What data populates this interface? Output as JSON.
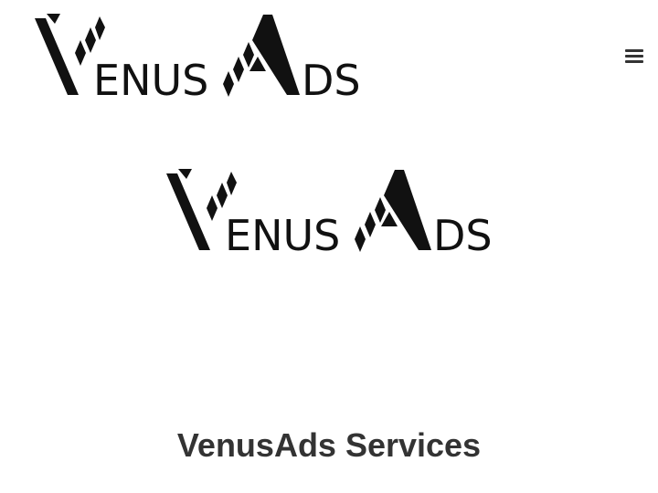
{
  "header": {
    "logo_alt": "VenusAds",
    "logo_text_1": "ENUS",
    "logo_text_2": "DS",
    "menu_icon": "hamburger-menu-icon"
  },
  "hero": {
    "logo_text_1": "ENUS",
    "logo_text_2": "DS"
  },
  "services": {
    "title": "VenusAds Services"
  },
  "colors": {
    "logo": "#111111",
    "title": "#333333",
    "background": "#ffffff"
  }
}
